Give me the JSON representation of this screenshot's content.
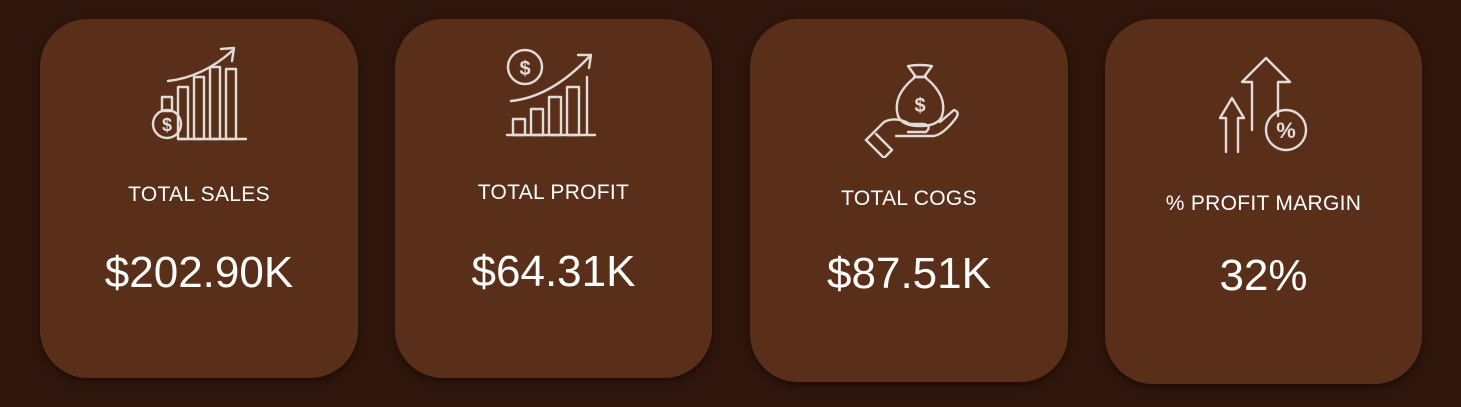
{
  "cards": [
    {
      "label": "TOTAL SALES",
      "value": "$202.90K",
      "icon": "sales-growth-chart-icon"
    },
    {
      "label": "TOTAL PROFIT",
      "value": "$64.31K",
      "icon": "profit-growth-chart-icon"
    },
    {
      "label": "TOTAL COGS",
      "value": "$87.51K",
      "icon": "money-bag-hand-icon"
    },
    {
      "label": "% PROFIT MARGIN",
      "value": "32%",
      "icon": "percent-arrows-up-icon"
    }
  ],
  "colors": {
    "background": "#2f160c",
    "card": "#5a2f19",
    "icon_stroke": "#e2dbd8",
    "text": "#ffffff"
  }
}
